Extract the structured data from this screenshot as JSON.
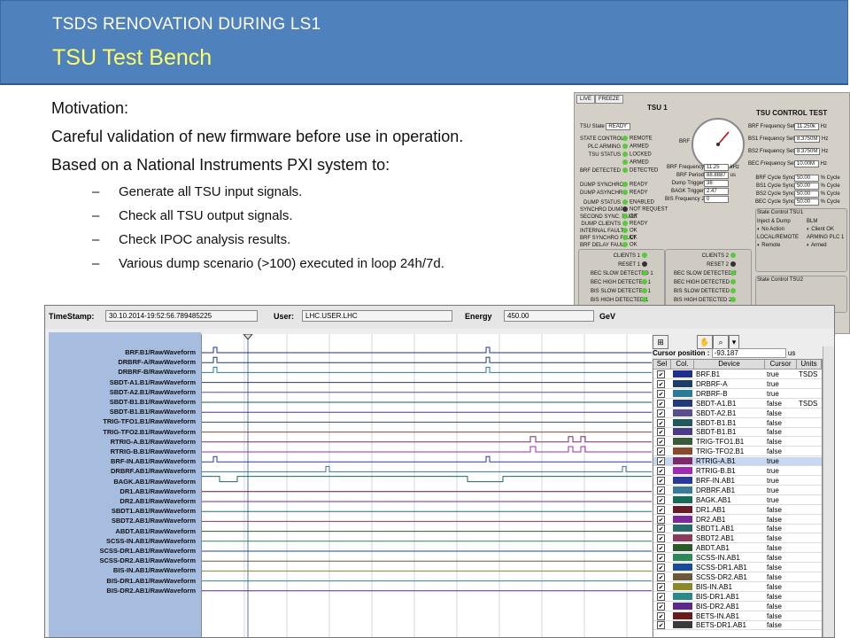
{
  "slide": {
    "subtitle": "TSDS RENOVATION DURING LS1",
    "title": "TSU Test Bench",
    "motivation": "Motivation:",
    "line1": "Careful validation of new firmware before use in operation.",
    "line2": "Based on a National Instruments PXI system to:",
    "bullets": [
      "Generate all TSU input signals.",
      "Check all TSU output signals.",
      "Check IPOC analysis results.",
      "Various dump scenario (>100) executed in loop 24h/7d."
    ]
  },
  "panel": {
    "tabs": [
      "LIVE",
      "FREEZE"
    ],
    "tsu_title": "TSU 1",
    "control_title": "TSU CONTROL TEST",
    "tsu_state_label": "TSU State",
    "tsu_state_value": "READY",
    "status_rows": [
      {
        "label": "STATE CONTROL",
        "value": "REMOTE"
      },
      {
        "label": "PLC ARMING",
        "value": "ARMED"
      },
      {
        "label": "TSU STATUS",
        "value": "LOCKED"
      },
      {
        "label": "",
        "value": "ARMED"
      },
      {
        "label": "BRF DETECTED",
        "value": "DETECTED"
      }
    ],
    "dump_rows": [
      {
        "label": "DUMP SYNCHRO",
        "value": "READY"
      },
      {
        "label": "DUMP ASYNCHRO",
        "value": "READY"
      }
    ],
    "fault_rows": [
      {
        "label": "DUMP STATUS",
        "value": "ENABLED"
      },
      {
        "label": "SYNCHRO DUMP",
        "value": "NOT REQUEST"
      },
      {
        "label": "SECOND SYNC. FAULT",
        "value": "OK"
      },
      {
        "label": "DUMP CLIENTS",
        "value": "READY"
      },
      {
        "label": "INTERNAL FAULT",
        "value": "OK"
      },
      {
        "label": "BRF SYNCHRO FAULT",
        "value": "OK"
      },
      {
        "label": "BRF DELAY FAULT",
        "value": "OK"
      },
      {
        "label": "SYNCHRO FAULT",
        "value": "OK"
      }
    ],
    "freq_rows": [
      {
        "label": "BRF Frequency",
        "value": "11.25",
        "unit": "kHz"
      },
      {
        "label": "BRF Period",
        "value": "88.8887",
        "unit": "us"
      },
      {
        "label": "Dump Trigger",
        "value": "38",
        "unit": ""
      },
      {
        "label": "BAGK Trigger",
        "value": "2.47",
        "unit": ""
      },
      {
        "label": "BIS Frequency 2",
        "value": "0",
        "unit": ""
      }
    ],
    "gauge_label": "BRF",
    "control_rows": [
      {
        "label": "BRF Frequency Setting",
        "value": "11.250k",
        "unit": "Hz"
      },
      {
        "label": "BS1 Frequency Setting",
        "value": "8.3750M",
        "unit": "Hz"
      },
      {
        "label": "BS2 Frequency Setting",
        "value": "8.3750M",
        "unit": "Hz"
      },
      {
        "label": "BEC Frequency Setting",
        "value": "10.00M",
        "unit": "Hz"
      }
    ],
    "cycle_rows": [
      {
        "label": "BRF Cycle Sync",
        "value": "50.00",
        "unit": "% Cycle"
      },
      {
        "label": "BS1 Cycle Sync",
        "value": "50.00",
        "unit": "% Cycle"
      },
      {
        "label": "BS2 Cycle Sync",
        "value": "50.00",
        "unit": "% Cycle"
      },
      {
        "label": "BEC Cycle Sync",
        "value": "50.00",
        "unit": "% Cycle"
      }
    ],
    "state_control_1": "State Control TSU1",
    "inject_dump": "Inject & Dump",
    "no_action": "No Action",
    "local_remote": "LOCAL/REMOTE",
    "remote": "Remote",
    "blm": "BLM",
    "client_ok": "Client OK",
    "arming_plc": "ARMING PLC 1",
    "armed": "Armed",
    "state_control_2": "State Control TSU2",
    "clients_rows": [
      "CLIENTS 1",
      "RESET 1",
      "BEC SLOW DETECTED 1",
      "BEC HIGH DETECTED 1",
      "BIS SLOW DETECTED 1",
      "BIS HIGH DETECTED 1"
    ],
    "clients_rows_2": [
      "CLIENTS 2",
      "RESET 2",
      "BEC SLOW DETECTED 2",
      "BEC HIGH DETECTED 2",
      "BIS SLOW DETECTED 2",
      "BIS HIGH DETECTED 2"
    ]
  },
  "viewer": {
    "timestamp_label": "TimeStamp:",
    "timestamp_value": "30.10.2014-19:52:56.789485225",
    "user_label": "User:",
    "user_value": "LHC.USER.LHC",
    "energy_label": "Energy",
    "energy_value": "450.00",
    "energy_unit": "GeV",
    "cursor_label": "Cursor position :",
    "cursor_value": "-93.187",
    "cursor_unit": "us",
    "columns": [
      "Sel",
      "Col.",
      "Device",
      "Cursor",
      "Units"
    ],
    "signals": [
      "BRF.B1/RawWaveform",
      "DRBRF-A/RawWaveform",
      "DRBRF-B/RawWaveform",
      "SBDT-A1.B1/RawWaveform",
      "SBDT-A2.B1/RawWaveform",
      "SBDT-B1.B1/RawWaveform",
      "SBDT-B1.B1/RawWaveform",
      "TRIG-TFO1.B1/RawWaveform",
      "TRIG-TFO2.B1/RawWaveform",
      "RTRIG-A.B1/RawWaveform",
      "RTRIG-B.B1/RawWaveform",
      "BRF-IN.AB1/RawWaveform",
      "DRBRF.AB1/RawWaveform",
      "BAGK.AB1/RawWaveform",
      "DR1.AB1/RawWaveform",
      "DR2.AB1/RawWaveform",
      "SBDT1.AB1/RawWaveform",
      "SBDT2.AB1/RawWaveform",
      "ABDT.AB1/RawWaveform",
      "SCSS-IN.AB1/RawWaveform",
      "SCSS-DR1.AB1/RawWaveform",
      "SCSS-DR2.AB1/RawWaveform",
      "BIS-IN.AB1/RawWaveform",
      "BIS-DR1.AB1/RawWaveform",
      "BIS-DR2.AB1/RawWaveform"
    ],
    "devices": [
      {
        "name": "BRF.B1",
        "cursor": "true",
        "units": "TSDS",
        "color": "#1f2f8f"
      },
      {
        "name": "DRBRF-A",
        "cursor": "true",
        "units": "",
        "color": "#1c3f6a"
      },
      {
        "name": "DRBRF-B",
        "cursor": "true",
        "units": "",
        "color": "#2a7a9a"
      },
      {
        "name": "SBDT-A1.B1",
        "cursor": "false",
        "units": "TSDS",
        "color": "#233b7a"
      },
      {
        "name": "SBDT-A2.B1",
        "cursor": "false",
        "units": "",
        "color": "#5a4f8a"
      },
      {
        "name": "SBDT-B1.B1",
        "cursor": "false",
        "units": "",
        "color": "#1f5a5a"
      },
      {
        "name": "SBDT-B1.B1",
        "cursor": "false",
        "units": "",
        "color": "#4a3a8a"
      },
      {
        "name": "TRIG-TFO1.B1",
        "cursor": "false",
        "units": "",
        "color": "#3a5a3a"
      },
      {
        "name": "TRIG-TFO2.B1",
        "cursor": "false",
        "units": "",
        "color": "#8a4a2a"
      },
      {
        "name": "RTRIG-A.B1",
        "cursor": "true",
        "units": "",
        "color": "#7a2a6a"
      },
      {
        "name": "RTRIG-B.B1",
        "cursor": "true",
        "units": "",
        "color": "#a02ab0"
      },
      {
        "name": "BRF-IN.AB1",
        "cursor": "true",
        "units": "",
        "color": "#2a3a9a"
      },
      {
        "name": "DRBRF.AB1",
        "cursor": "true",
        "units": "",
        "color": "#3a7a9a"
      },
      {
        "name": "BAGK.AB1",
        "cursor": "true",
        "units": "",
        "color": "#1a6a5a"
      },
      {
        "name": "DR1.AB1",
        "cursor": "false",
        "units": "",
        "color": "#6a1a2a"
      },
      {
        "name": "DR2.AB1",
        "cursor": "false",
        "units": "",
        "color": "#7a2a9a"
      },
      {
        "name": "SBDT1.AB1",
        "cursor": "false",
        "units": "",
        "color": "#2a6a6a"
      },
      {
        "name": "SBDT2.AB1",
        "cursor": "false",
        "units": "",
        "color": "#8a3a5a"
      },
      {
        "name": "ABDT.AB1",
        "cursor": "false",
        "units": "",
        "color": "#2a5a2a"
      },
      {
        "name": "SCSS-IN.AB1",
        "cursor": "false",
        "units": "",
        "color": "#2a8a5a"
      },
      {
        "name": "SCSS-DR1.AB1",
        "cursor": "false",
        "units": "",
        "color": "#1a4a9a"
      },
      {
        "name": "SCSS-DR2.AB1",
        "cursor": "false",
        "units": "",
        "color": "#6a5a3a"
      },
      {
        "name": "BIS-IN.AB1",
        "cursor": "false",
        "units": "",
        "color": "#8a8a2a"
      },
      {
        "name": "BIS-DR1.AB1",
        "cursor": "false",
        "units": "",
        "color": "#2a8a8a"
      },
      {
        "name": "BIS-DR2.AB1",
        "cursor": "false",
        "units": "",
        "color": "#5a2a8a"
      },
      {
        "name": "BETS-IN.AB1",
        "cursor": "false",
        "units": "",
        "color": "#6a1a1a"
      },
      {
        "name": "BETS-DR1.AB1",
        "cursor": "false",
        "units": "",
        "color": "#3a3a3a"
      }
    ],
    "selected_device_index": 9,
    "accent": "#4f81bd"
  }
}
